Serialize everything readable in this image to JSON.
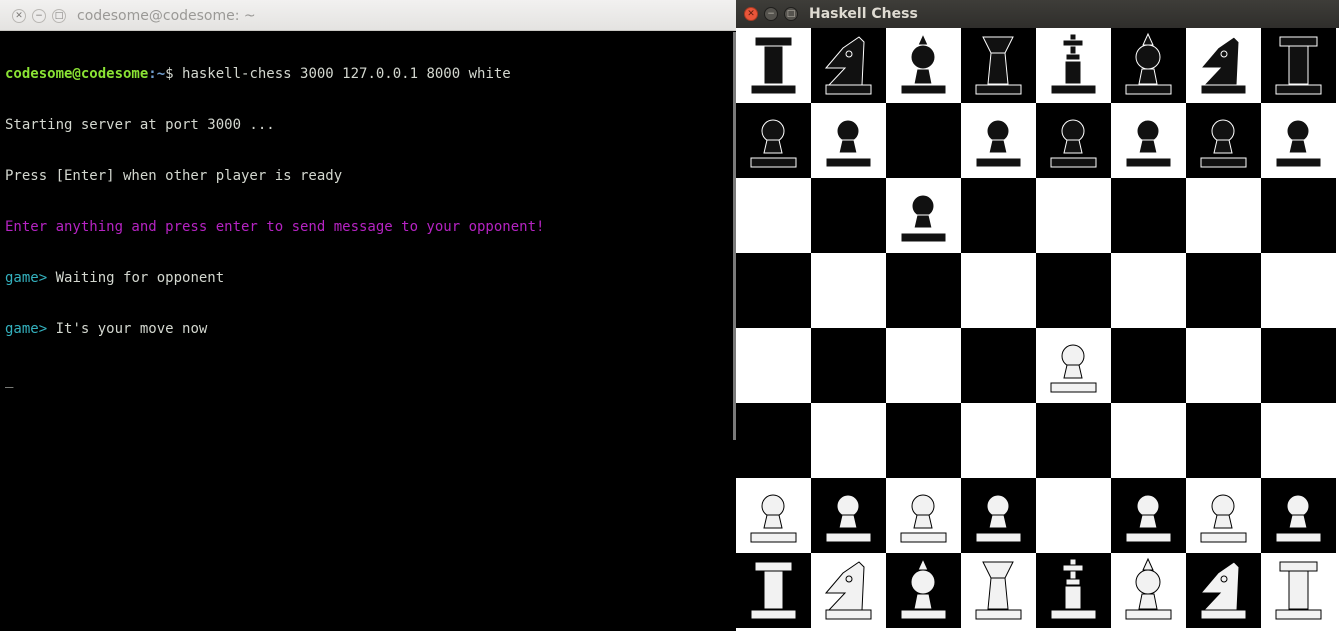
{
  "terminal": {
    "title": "codesome@codesome: ~",
    "lines": [
      {
        "user": "codesome@codesome",
        "sep": ":~",
        "cmd": "$ haskell-chess 3000 127.0.0.1 8000 white"
      },
      {
        "text": "Starting server at port 3000 ..."
      },
      {
        "text": "Press [Enter] when other player is ready"
      },
      {
        "highlight": "Enter anything and press enter to send message to your opponent!"
      },
      {
        "prompt": "game>",
        "text": " Waiting for opponent"
      },
      {
        "prompt": "game>",
        "text": " It's your move now"
      },
      {
        "cursor": "_"
      }
    ]
  },
  "chess": {
    "title": "Haskell Chess",
    "colors": {
      "dark": "#000000",
      "light": "#ffffff",
      "white_piece": "#f2f2f2",
      "black_piece": "#111111"
    },
    "board": [
      [
        "bR",
        "bN",
        "bB",
        "bQ",
        "bK",
        "bB",
        "bN",
        "bR"
      ],
      [
        "bP",
        "bP",
        "",
        "bP",
        "bP",
        "bP",
        "bP",
        "bP"
      ],
      [
        "",
        "",
        "bP",
        "",
        "",
        "",
        "",
        ""
      ],
      [
        "",
        "",
        "",
        "",
        "",
        "",
        "",
        ""
      ],
      [
        "",
        "",
        "",
        "",
        "wP",
        "",
        "",
        ""
      ],
      [
        "",
        "",
        "",
        "",
        "",
        "",
        "",
        ""
      ],
      [
        "wP",
        "wP",
        "wP",
        "wP",
        "",
        "wP",
        "wP",
        "wP"
      ],
      [
        "wR",
        "wN",
        "wB",
        "wQ",
        "wK",
        "wB",
        "wN",
        "wR"
      ]
    ],
    "piece_names": {
      "P": "pawn",
      "R": "rook",
      "N": "knight",
      "B": "bishop",
      "Q": "queen",
      "K": "king"
    }
  }
}
